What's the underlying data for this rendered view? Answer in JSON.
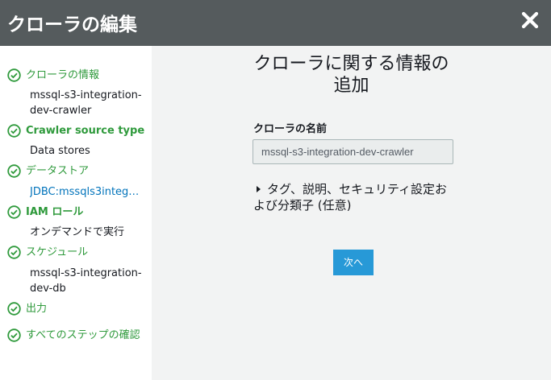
{
  "header": {
    "title": "クローラの編集",
    "close_icon": "close-icon"
  },
  "colors": {
    "header_bg": "#555b5d",
    "step_green": "#2f9a3c",
    "link_blue": "#0073bb",
    "button_blue": "#2799d7"
  },
  "sidebar": {
    "steps": [
      {
        "label": "クローラの情報",
        "value": "mssql-s3-integration-dev-crawler",
        "icon": "check-circle-icon"
      },
      {
        "label": "Crawler source type",
        "value": "Data stores",
        "icon": "check-circle-icon"
      },
      {
        "label": "データストア",
        "value": "JDBC:mssqls3integ…",
        "icon": "check-circle-icon"
      },
      {
        "label": "IAM ロール",
        "value": "オンデマンドで実行",
        "icon": "check-circle-icon"
      },
      {
        "label": "スケジュール",
        "value": "mssql-s3-integration-dev-db",
        "icon": "check-circle-icon"
      },
      {
        "label": "出力",
        "icon": "check-circle-icon"
      },
      {
        "label": "すべてのステップの確認",
        "icon": "check-circle-icon"
      }
    ]
  },
  "main": {
    "title": "クローラに関する情報の追加",
    "name_field": {
      "label": "クローラの名前",
      "value": "mssql-s3-integration-dev-crawler"
    },
    "expander": {
      "label": "タグ、説明、セキュリティ設定および分類子 (任意)",
      "icon": "caret-right-icon"
    },
    "next_button": "次へ"
  }
}
